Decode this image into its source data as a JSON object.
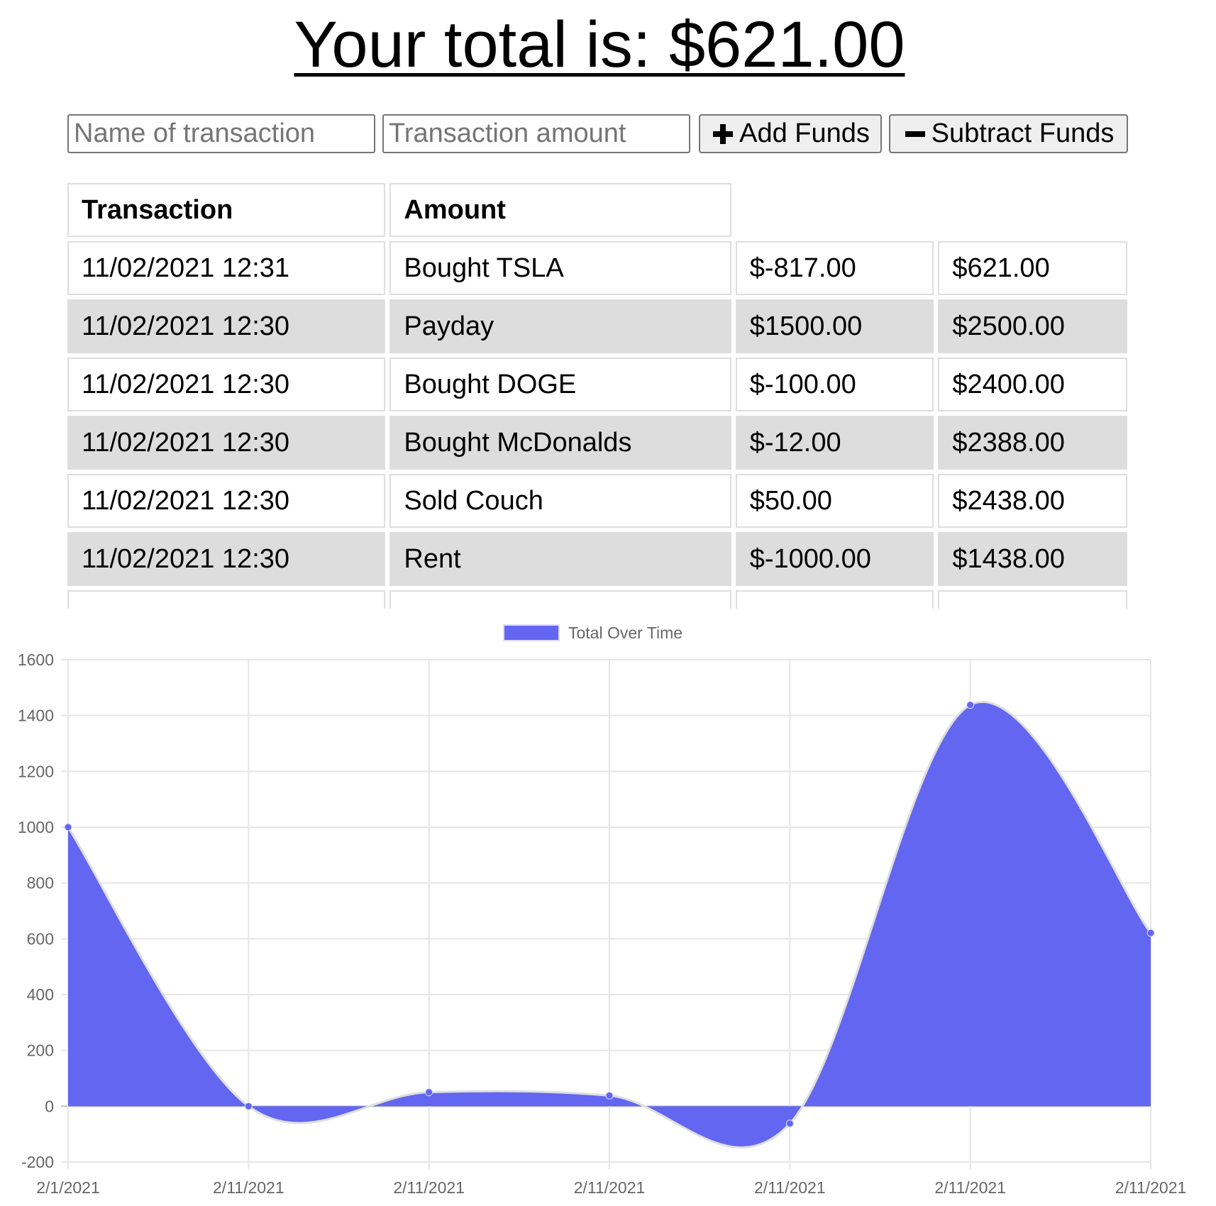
{
  "header": {
    "title": "Your total is: $621.00"
  },
  "form": {
    "name_placeholder": "Name of transaction",
    "amount_placeholder": "Transaction amount",
    "add_label": "Add Funds",
    "subtract_label": "Subtract Funds"
  },
  "table": {
    "headers": [
      "Transaction",
      "Amount"
    ],
    "rows": [
      {
        "date": "11/02/2021 12:31",
        "name": "Bought TSLA",
        "amount": "$-817.00",
        "total": "$621.00"
      },
      {
        "date": "11/02/2021 12:30",
        "name": "Payday",
        "amount": "$1500.00",
        "total": "$2500.00"
      },
      {
        "date": "11/02/2021 12:30",
        "name": "Bought DOGE",
        "amount": "$-100.00",
        "total": "$2400.00"
      },
      {
        "date": "11/02/2021 12:30",
        "name": "Bought McDonalds",
        "amount": "$-12.00",
        "total": "$2388.00"
      },
      {
        "date": "11/02/2021 12:30",
        "name": "Sold Couch",
        "amount": "$50.00",
        "total": "$2438.00"
      },
      {
        "date": "11/02/2021 12:30",
        "name": "Rent",
        "amount": "$-1000.00",
        "total": "$1438.00"
      }
    ]
  },
  "colors": {
    "fill": "#6366f1",
    "grid": "#e6e6e6",
    "tick_text": "#666666"
  },
  "chart_data": {
    "type": "area",
    "legend": {
      "label": "Total Over Time",
      "placement": "top-center"
    },
    "grid": true,
    "x": [
      "2/1/2021",
      "2/11/2021",
      "2/11/2021",
      "2/11/2021",
      "2/11/2021",
      "2/11/2021",
      "2/11/2021"
    ],
    "series": [
      {
        "name": "Total Over Time",
        "values": [
          1000,
          0,
          50,
          38,
          -62,
          1438,
          621
        ]
      }
    ],
    "ylim": [
      -200,
      1600
    ],
    "yticks": [
      1600,
      1400,
      1200,
      1000,
      800,
      600,
      400,
      200,
      0,
      -200
    ]
  }
}
